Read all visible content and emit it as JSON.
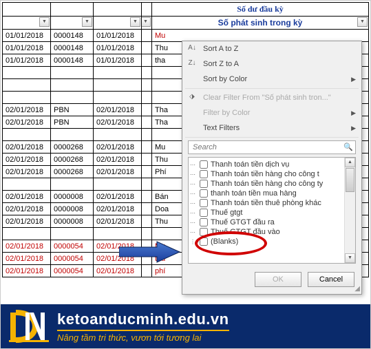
{
  "headers": {
    "soDuDauKy": "Số dư đầu kỳ",
    "soPhatSinh": "Số phát sinh trong kỳ"
  },
  "rows": [
    [
      "01/01/2018",
      "0000148",
      "01/01/2018",
      "",
      "Mu",
      "",
      ""
    ],
    [
      "01/01/2018",
      "0000148",
      "01/01/2018",
      "",
      "Thu",
      "",
      ""
    ],
    [
      "01/01/2018",
      "0000148",
      "01/01/2018",
      "",
      "tha",
      "",
      ""
    ],
    [
      "",
      "",
      "",
      "",
      "",
      "",
      ""
    ],
    [
      "",
      "",
      "",
      "",
      "",
      "",
      ""
    ],
    [
      "",
      "",
      "",
      "",
      "",
      "",
      ""
    ],
    [
      "02/01/2018",
      "PBN",
      "02/01/2018",
      "",
      "Tha",
      "",
      ""
    ],
    [
      "02/01/2018",
      "PBN",
      "02/01/2018",
      "",
      "Tha",
      "",
      ""
    ],
    [
      "",
      "",
      "",
      "",
      "",
      "",
      ""
    ],
    [
      "02/01/2018",
      "0000268",
      "02/01/2018",
      "",
      "Mu",
      "",
      ""
    ],
    [
      "02/01/2018",
      "0000268",
      "02/01/2018",
      "",
      "Thu",
      "",
      ""
    ],
    [
      "02/01/2018",
      "0000268",
      "02/01/2018",
      "",
      "Phí",
      "",
      ""
    ],
    [
      "",
      "",
      "",
      "",
      "",
      "",
      ""
    ],
    [
      "02/01/2018",
      "0000008",
      "02/01/2018",
      "",
      "Bán",
      "",
      ""
    ],
    [
      "02/01/2018",
      "0000008",
      "02/01/2018",
      "",
      "Doa",
      "",
      ""
    ],
    [
      "02/01/2018",
      "0000008",
      "02/01/2018",
      "",
      "Thu",
      "",
      ""
    ],
    [
      "",
      "",
      "",
      "",
      "",
      "",
      ""
    ],
    [
      "02/01/2018",
      "0000054",
      "02/01/2018",
      "",
      "Mu",
      "",
      "red"
    ],
    [
      "02/01/2018",
      "0000054",
      "02/01/2018",
      "",
      "thu",
      "",
      "red"
    ],
    [
      "02/01/2018",
      "0000054",
      "02/01/2018",
      "",
      "phí",
      "",
      "red"
    ]
  ],
  "menu": {
    "sortAZ": "Sort A to Z",
    "sortZA": "Sort Z to A",
    "sortColor": "Sort by Color",
    "clearFilter": "Clear Filter From \"Số phát sinh tron...\"",
    "filterColor": "Filter by Color",
    "textFilters": "Text Filters",
    "searchPlaceholder": "Search",
    "ok": "OK",
    "cancel": "Cancel"
  },
  "checks": [
    "Thanh toán tiền dịch vụ",
    "Thanh toán tiền hàng cho công t",
    "Thanh toán tiền hàng cho công ty",
    "thanh toán tiền mua hàng",
    "Thanh toán tiền thuê phòng khác",
    "Thuế gtgt",
    "Thuế GTGT đầu ra",
    "Thuế GTGT đầu vào",
    "(Blanks)"
  ],
  "footer": {
    "url": "ketoanducminh.edu.vn",
    "tag": "Nâng tầm tri thức, vươn tới tương lai"
  }
}
